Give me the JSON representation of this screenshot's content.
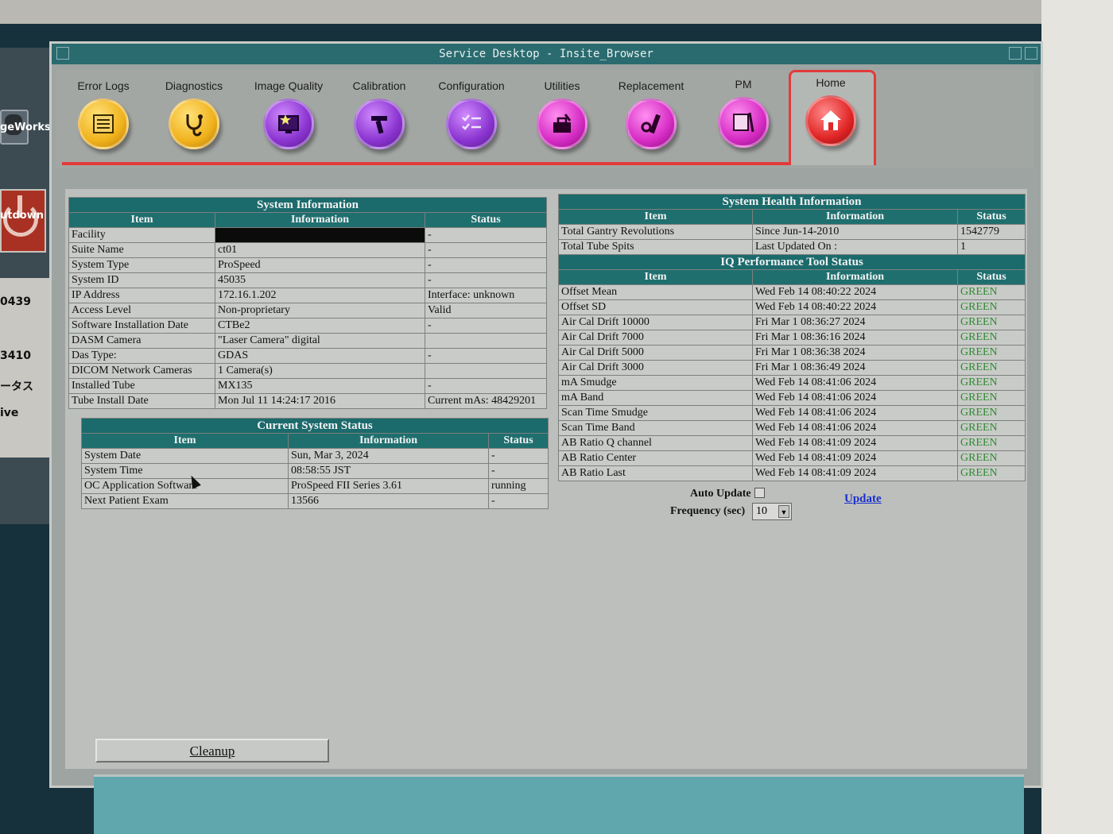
{
  "window": {
    "title": "Service Desktop - Insite_Browser"
  },
  "desktop": {
    "icon1_label": "geWorks",
    "shutdown_label": "utdown",
    "panel_lines": [
      "0439",
      "3410",
      "ータス",
      "ive"
    ]
  },
  "toolbar": {
    "tools": [
      {
        "label": "Error Logs",
        "icon": "log-book-icon"
      },
      {
        "label": "Diagnostics",
        "icon": "stethoscope-icon"
      },
      {
        "label": "Image Quality",
        "icon": "monitor-star-icon"
      },
      {
        "label": "Calibration",
        "icon": "caliper-icon"
      },
      {
        "label": "Configuration",
        "icon": "checklist-icon"
      },
      {
        "label": "Utilities",
        "icon": "toolbox-icon"
      },
      {
        "label": "Replacement",
        "icon": "wrench-bolt-icon"
      },
      {
        "label": "PM",
        "icon": "calendar-wrench-icon"
      },
      {
        "label": "Home",
        "icon": "house-icon"
      }
    ]
  },
  "system_info": {
    "caption": "System Information",
    "headers": [
      "Item",
      "Information",
      "Status"
    ],
    "rows": [
      [
        "Facility",
        "",
        "-"
      ],
      [
        "Suite Name",
        "ct01",
        "-"
      ],
      [
        "System Type",
        "ProSpeed",
        "-"
      ],
      [
        "System ID",
        "45035",
        "-"
      ],
      [
        "IP Address",
        "172.16.1.202",
        "Interface: unknown"
      ],
      [
        "Access Level",
        "Non-proprietary",
        "Valid"
      ],
      [
        "Software Installation Date",
        "CTBe2",
        "-"
      ],
      [
        "DASM Camera",
        "\"Laser Camera\" digital",
        ""
      ],
      [
        "Das Type:",
        "GDAS",
        "-"
      ],
      [
        "DICOM Network Cameras",
        "1 Camera(s)",
        ""
      ],
      [
        "Installed Tube",
        "MX135",
        "-"
      ],
      [
        "Tube Install Date",
        "Mon Jul 11 14:24:17 2016",
        "Current mAs: 48429201"
      ]
    ]
  },
  "current_status": {
    "caption": "Current System Status",
    "headers": [
      "Item",
      "Information",
      "Status"
    ],
    "rows": [
      [
        "System Date",
        "Sun, Mar 3, 2024",
        "-"
      ],
      [
        "System Time",
        "08:58:55 JST",
        "-"
      ],
      [
        "OC Application Software",
        "ProSpeed FII Series 3.61",
        "running"
      ],
      [
        "Next Patient Exam",
        "13566",
        "-"
      ]
    ]
  },
  "health_info": {
    "caption": "System Health Information",
    "headers": [
      "Item",
      "Information",
      "Status"
    ],
    "rows": [
      [
        "Total Gantry Revolutions",
        "Since Jun-14-2010",
        "1542779"
      ],
      [
        "Total Tube Spits",
        "Last Updated On :",
        "1"
      ]
    ]
  },
  "iq_status": {
    "caption": "IQ Performance Tool Status",
    "headers": [
      "Item",
      "Information",
      "Status"
    ],
    "rows": [
      [
        "Offset Mean",
        "Wed Feb 14 08:40:22 2024",
        "GREEN"
      ],
      [
        "Offset SD",
        "Wed Feb 14 08:40:22 2024",
        "GREEN"
      ],
      [
        "Air Cal Drift 10000",
        "Fri Mar 1 08:36:27 2024",
        "GREEN"
      ],
      [
        "Air Cal Drift 7000",
        "Fri Mar 1 08:36:16 2024",
        "GREEN"
      ],
      [
        "Air Cal Drift 5000",
        "Fri Mar 1 08:36:38 2024",
        "GREEN"
      ],
      [
        "Air Cal Drift 3000",
        "Fri Mar 1 08:36:49 2024",
        "GREEN"
      ],
      [
        "mA Smudge",
        "Wed Feb 14 08:41:06 2024",
        "GREEN"
      ],
      [
        "mA Band",
        "Wed Feb 14 08:41:06 2024",
        "GREEN"
      ],
      [
        "Scan Time Smudge",
        "Wed Feb 14 08:41:06 2024",
        "GREEN"
      ],
      [
        "Scan Time Band",
        "Wed Feb 14 08:41:06 2024",
        "GREEN"
      ],
      [
        "AB Ratio Q channel",
        "Wed Feb 14 08:41:09 2024",
        "GREEN"
      ],
      [
        "AB Ratio Center",
        "Wed Feb 14 08:41:09 2024",
        "GREEN"
      ],
      [
        "AB Ratio Last",
        "Wed Feb 14 08:41:09 2024",
        "GREEN"
      ]
    ]
  },
  "controls": {
    "auto_update_label": "Auto Update",
    "frequency_label": "Frequency (sec)",
    "frequency_value": "10",
    "update_link": "Update",
    "cleanup_button": "Cleanup"
  },
  "colors": {
    "header_teal": "#1f6f6f",
    "status_green": "#2f8a33",
    "home_red": "#e33a3a"
  }
}
